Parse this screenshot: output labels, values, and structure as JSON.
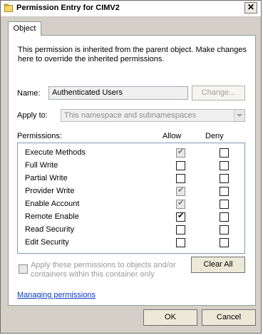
{
  "window": {
    "title": "Permission Entry for CIMV2",
    "close_glyph": "✕"
  },
  "tabs": [
    {
      "label": "Object"
    }
  ],
  "info_text": "This permission is inherited from the parent object. Make changes here to override the inherited permissions.",
  "name": {
    "label": "Name:",
    "value": "Authenticated Users",
    "change_button": "Change..."
  },
  "apply_to": {
    "label": "Apply to:",
    "value": "This namespace and subnamespaces"
  },
  "permissions": {
    "label": "Permissions:",
    "allow_header": "Allow",
    "deny_header": "Deny",
    "items": [
      {
        "name": "Execute Methods",
        "allow": true,
        "allow_inherited": true,
        "deny": false
      },
      {
        "name": "Full Write",
        "allow": false,
        "allow_inherited": false,
        "deny": false
      },
      {
        "name": "Partial Write",
        "allow": false,
        "allow_inherited": false,
        "deny": false
      },
      {
        "name": "Provider Write",
        "allow": true,
        "allow_inherited": true,
        "deny": false
      },
      {
        "name": "Enable Account",
        "allow": true,
        "allow_inherited": true,
        "deny": false
      },
      {
        "name": "Remote Enable",
        "allow": true,
        "allow_inherited": false,
        "deny": false
      },
      {
        "name": "Read Security",
        "allow": false,
        "allow_inherited": false,
        "deny": false
      },
      {
        "name": "Edit Security",
        "allow": false,
        "allow_inherited": false,
        "deny": false
      }
    ]
  },
  "apply_permissions_text": "Apply these permissions to objects and/or containers within this container only",
  "clear_all_label": "Clear All",
  "managing_link": "Managing permissions",
  "footer": {
    "ok_label": "OK",
    "cancel_label": "Cancel"
  },
  "colors": {
    "link": "#0b37c4",
    "dialog_bg": "#d4d0c8",
    "panel_bg": "#ffffff"
  }
}
